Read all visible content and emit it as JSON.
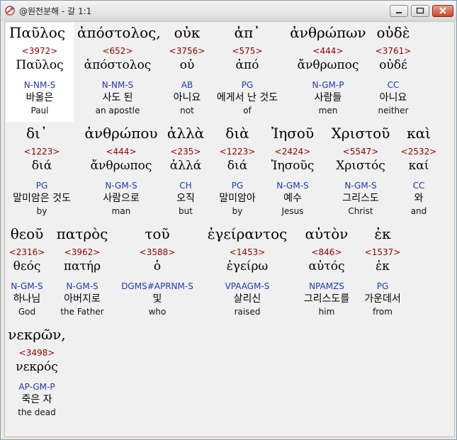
{
  "window": {
    "title": "@원전분해 - 갈 1:1",
    "controls": {
      "minimize": "minimize-icon",
      "maximize": "maximize-icon",
      "close": "close-icon"
    }
  },
  "colors": {
    "strong": "#8b0000",
    "morph": "#1e3aa8",
    "text": "#000000"
  },
  "lines": [
    {
      "words": [
        {
          "greek": "Παῦλος",
          "strong": "<3972>",
          "lemma": "Παῦλος",
          "morph": "N-NM-S",
          "korean": "바울은",
          "english": "Paul"
        },
        {
          "greek": "ἀπόστολος,",
          "strong": "<652>",
          "lemma": "ἀπόστολος",
          "morph": "N-NM-S",
          "korean": "사도 된",
          "english": "an apostle"
        },
        {
          "greek": "οὐκ",
          "strong": "<3756>",
          "lemma": "οὐ",
          "morph": "AB",
          "korean": "아니요",
          "english": "not"
        },
        {
          "greek": "ἀπ᾽",
          "strong": "<575>",
          "lemma": "ἀπό",
          "morph": "PG",
          "korean": "에게서 난 것도",
          "english": "of"
        },
        {
          "greek": "ἀνθρώπων",
          "strong": "<444>",
          "lemma": "ἄνθρωπος",
          "morph": "N-GM-P",
          "korean": "사람들",
          "english": "men"
        },
        {
          "greek": "οὐδὲ",
          "strong": "<3761>",
          "lemma": "οὐδέ",
          "morph": "CC",
          "korean": "아니요",
          "english": "neither"
        }
      ]
    },
    {
      "words": [
        {
          "greek": "δι᾽",
          "strong": "<1223>",
          "lemma": "διά",
          "morph": "PG",
          "korean": "말미암은 것도",
          "english": "by"
        },
        {
          "greek": "ἀνθρώπου",
          "strong": "<444>",
          "lemma": "ἄνθρωπος",
          "morph": "N-GM-S",
          "korean": "사람으로",
          "english": "man"
        },
        {
          "greek": "ἀλλὰ",
          "strong": "<235>",
          "lemma": "ἀλλά",
          "morph": "CH",
          "korean": "오직",
          "english": "but"
        },
        {
          "greek": "διὰ",
          "strong": "<1223>",
          "lemma": "διά",
          "morph": "PG",
          "korean": "말미암아",
          "english": "by"
        },
        {
          "greek": "Ἰησοῦ",
          "strong": "<2424>",
          "lemma": "Ἰησοῦς",
          "morph": "N-GM-S",
          "korean": "예수",
          "english": "Jesus"
        },
        {
          "greek": "Χριστοῦ",
          "strong": "<5547>",
          "lemma": "Χριστός",
          "morph": "N-GM-S",
          "korean": "그리스도",
          "english": "Christ"
        },
        {
          "greek": "καὶ",
          "strong": "<2532>",
          "lemma": "καί",
          "morph": "CC",
          "korean": "와",
          "english": "and"
        }
      ]
    },
    {
      "words": [
        {
          "greek": "θεοῦ",
          "strong": "<2316>",
          "lemma": "θεός",
          "morph": "N-GM-S",
          "korean": "하나님",
          "english": "God"
        },
        {
          "greek": "πατρὸς",
          "strong": "<3962>",
          "lemma": "πατήρ",
          "morph": "N-GM-S",
          "korean": "아버지로",
          "english": "the Father"
        },
        {
          "greek": "τοῦ",
          "strong": "<3588>",
          "lemma": "ὁ",
          "morph": "DGMS#APRNM-S",
          "korean": "및",
          "english": "who"
        },
        {
          "greek": "ἐγείραντος",
          "strong": "<1453>",
          "lemma": "ἐγείρω",
          "morph": "VPAAGM-S",
          "korean": "살리신",
          "english": "raised"
        },
        {
          "greek": "αὐτὸν",
          "strong": "<846>",
          "lemma": "αὐτός",
          "morph": "NPAMZS",
          "korean": "그리스도를",
          "english": "him"
        },
        {
          "greek": "ἐκ",
          "strong": "<1537>",
          "lemma": "ἐκ",
          "morph": "PG",
          "korean": "가운데서",
          "english": "from"
        }
      ]
    },
    {
      "words": [
        {
          "greek": "νεκρῶν,",
          "strong": "<3498>",
          "lemma": "νεκρός",
          "morph": "AP-GM-P",
          "korean": "죽은 자",
          "english": "the dead"
        }
      ]
    }
  ]
}
